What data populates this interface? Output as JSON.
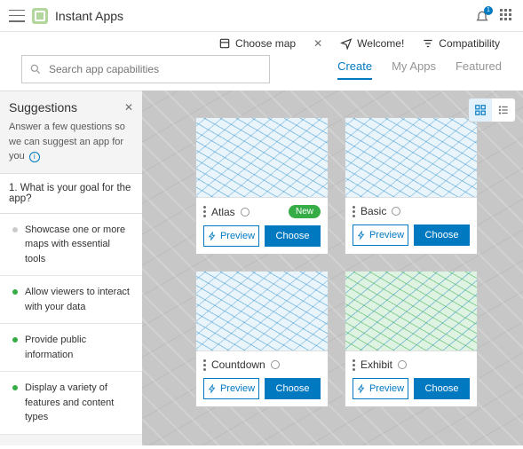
{
  "header": {
    "title": "Instant Apps",
    "notification_count": "1"
  },
  "actions": {
    "choose_map": "Choose map",
    "welcome": "Welcome!",
    "compatibility": "Compatibility"
  },
  "search": {
    "placeholder": "Search app capabilities"
  },
  "tabs": {
    "create": "Create",
    "my_apps": "My Apps",
    "featured": "Featured"
  },
  "sidebar": {
    "title": "Suggestions",
    "description": "Answer a few questions so we can suggest an app for you",
    "question": "1. What is your goal for the app?",
    "options": [
      "Showcase one or more maps with essential tools",
      "Allow viewers to interact with your data",
      "Provide public information",
      "Display a variety of features and content types"
    ]
  },
  "badges": {
    "new": "New"
  },
  "buttons": {
    "preview": "Preview",
    "choose": "Choose"
  },
  "cards": [
    {
      "name": "Atlas",
      "new": true,
      "thumb": "blue"
    },
    {
      "name": "Basic",
      "new": false,
      "thumb": "blue"
    },
    {
      "name": "Countdown",
      "new": false,
      "thumb": "blue"
    },
    {
      "name": "Exhibit",
      "new": false,
      "thumb": "green"
    }
  ]
}
